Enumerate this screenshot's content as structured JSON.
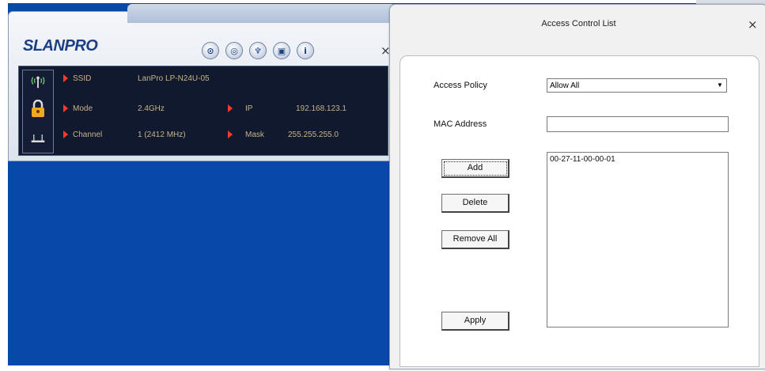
{
  "utility": {
    "logo": "LANPRO",
    "toolbar_icons": [
      "wps-icon",
      "settings-icon",
      "antenna-icon",
      "network-icon",
      "info-icon"
    ],
    "toolbar_glyphs": [
      "⊙",
      "◎",
      "♆",
      "▣",
      "i"
    ],
    "close_label": "×",
    "info": {
      "ssid_label": "SSID",
      "ssid_value": "LanPro LP-N24U-05",
      "mode_label": "Mode",
      "mode_value": "2.4GHz",
      "channel_label": "Channel",
      "channel_value": "1 (2412 MHz)",
      "ip_label": "IP",
      "ip_value": "192.168.123.1",
      "mask_label": "Mask",
      "mask_value": "255.255.255.0"
    }
  },
  "acl": {
    "title": "Access Control List",
    "close_label": "×",
    "access_policy_label": "Access Policy",
    "access_policy_value": "Allow All",
    "mac_address_label": "MAC Address",
    "mac_address_value": "",
    "add_label": "Add",
    "delete_label": "Delete",
    "remove_all_label": "Remove All",
    "apply_label": "Apply",
    "mac_list": [
      "00-27-11-00-00-01"
    ]
  },
  "colors": {
    "desktop": "#0748a8",
    "info_panel": "#10192e",
    "arrow": "#ff3a2a"
  }
}
